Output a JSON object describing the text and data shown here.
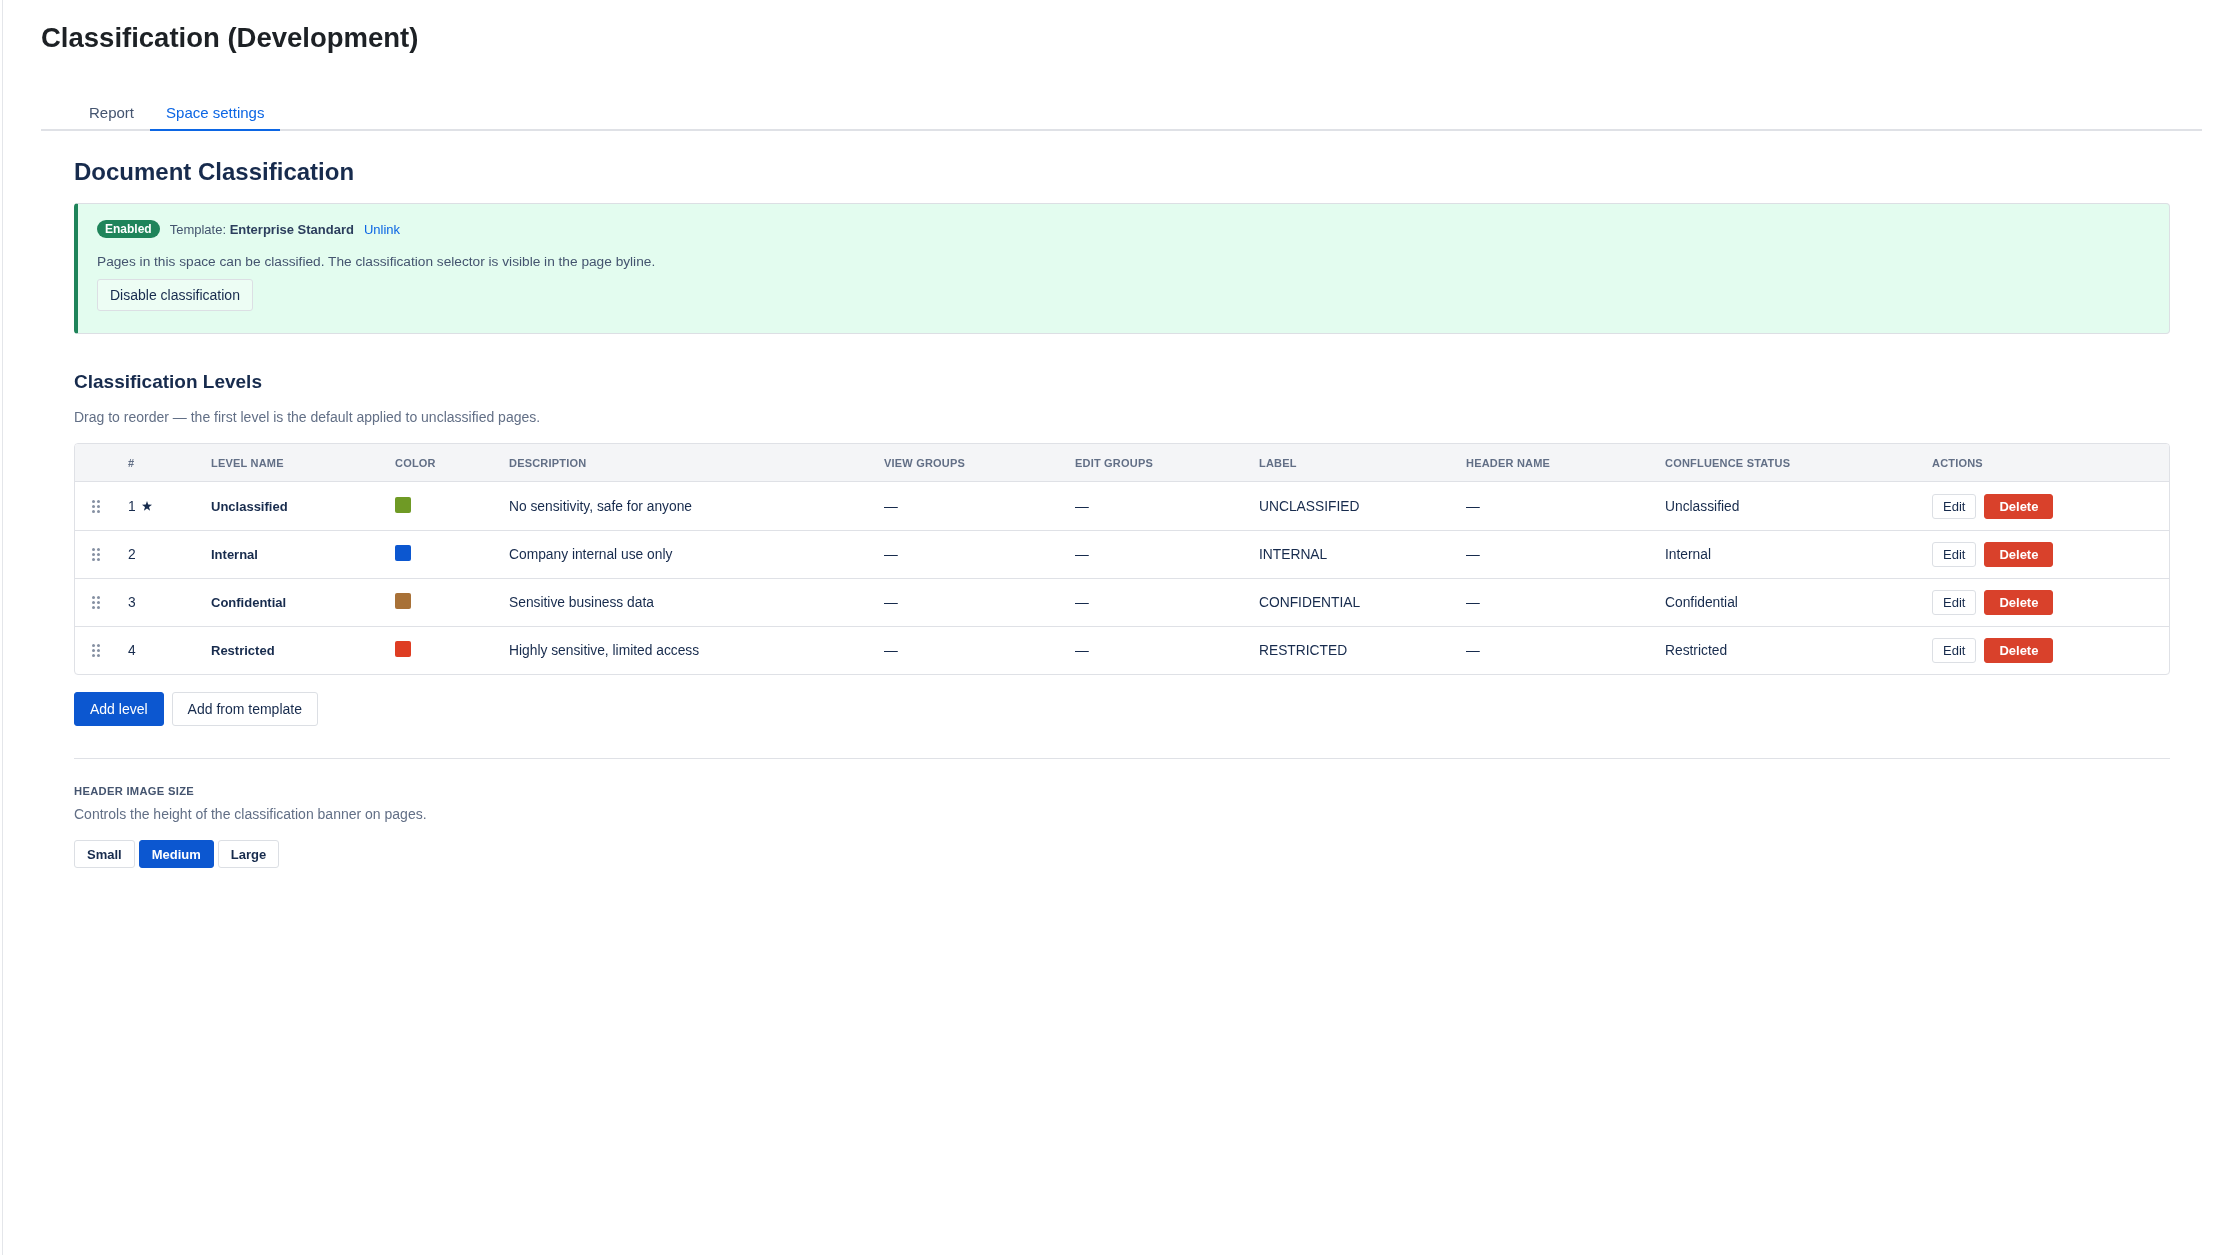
{
  "page": {
    "title": "Classification (Development)"
  },
  "tabs": [
    {
      "label": "Report",
      "selected": false
    },
    {
      "label": "Space settings",
      "selected": true
    }
  ],
  "document_classification": {
    "heading": "Document Classification",
    "banner": {
      "enabled": true,
      "status_badge": "Enabled",
      "template": "Template: **Enterprise Standard**",
      "unlink_link": "Unlink",
      "description": "Pages in this space can be classified. The classification selector is visible in the page byline.",
      "button": "Disable classification"
    }
  },
  "classification_levels": {
    "heading": "Classification Levels",
    "hint": "Drag to reorder — the first level is the default applied to unclassified pages.",
    "table": {
      "columns": [
        "#",
        "LEVEL NAME",
        "COLOR",
        "DESCRIPTION",
        "VIEW GROUPS",
        "EDIT GROUPS",
        "LABEL",
        "HEADER NAME",
        "CONFLUENCE STATUS",
        "ACTIONS"
      ],
      "rows": [
        {
          "number": "1",
          "default": true,
          "level_name": "Unclassified",
          "color": "#6f9a25",
          "description": "No sensitivity, safe for anyone",
          "view_groups": "—",
          "edit_groups": "—",
          "label": "UNCLASSIFIED",
          "header_name": "—",
          "confluence_status": "Unclassified",
          "actions": [
            {
              "label": "Edit",
              "kind": "secondary"
            },
            {
              "label": "Delete",
              "kind": "danger"
            }
          ]
        },
        {
          "number": "2",
          "default": false,
          "level_name": "Internal",
          "color": "#0c57d0",
          "description": "Company internal use only",
          "view_groups": "—",
          "edit_groups": "—",
          "label": "INTERNAL",
          "header_name": "—",
          "confluence_status": "Internal",
          "actions": [
            {
              "label": "Edit",
              "kind": "secondary"
            },
            {
              "label": "Delete",
              "kind": "danger"
            }
          ]
        },
        {
          "number": "3",
          "default": false,
          "level_name": "Confidential",
          "color": "#a87137",
          "description": "Sensitive business data",
          "view_groups": "—",
          "edit_groups": "—",
          "label": "CONFIDENTIAL",
          "header_name": "—",
          "confluence_status": "Confidential",
          "actions": [
            {
              "label": "Edit",
              "kind": "secondary"
            },
            {
              "label": "Delete",
              "kind": "danger"
            }
          ]
        },
        {
          "number": "4",
          "default": false,
          "level_name": "Restricted",
          "color": "#de3d23",
          "description": "Highly sensitive, limited access",
          "view_groups": "—",
          "edit_groups": "—",
          "label": "RESTRICTED",
          "header_name": "—",
          "confluence_status": "Restricted",
          "actions": [
            {
              "label": "Edit",
              "kind": "secondary"
            },
            {
              "label": "Delete",
              "kind": "danger"
            }
          ]
        }
      ]
    },
    "buttons": [
      {
        "label": "Add level",
        "kind": "primary"
      },
      {
        "label": "Add from template",
        "kind": "secondary"
      }
    ]
  },
  "header_image_size": {
    "label": "HEADER IMAGE SIZE",
    "hint": "Controls the height of the classification banner on pages.",
    "options": [
      {
        "label": "Small",
        "selected": false
      },
      {
        "label": "Medium",
        "selected": true
      },
      {
        "label": "Large",
        "selected": false
      }
    ]
  }
}
